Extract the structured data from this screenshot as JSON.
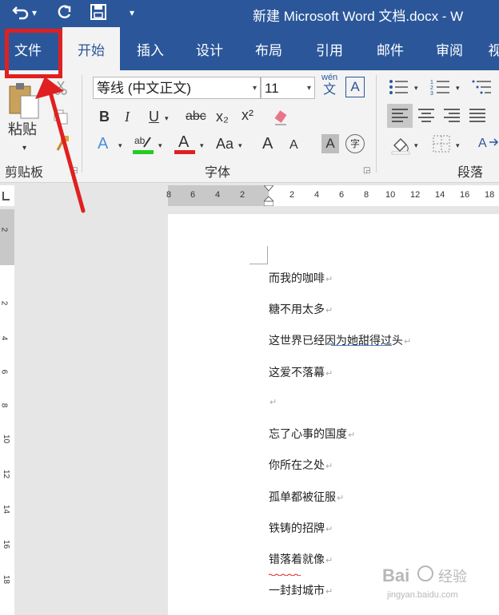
{
  "window": {
    "title": "新建 Microsoft Word 文档.docx  -  W",
    "undo_icon": "undo-icon",
    "redo_icon": "redo-icon",
    "save_icon": "save-icon",
    "qat_dropdown": "▾"
  },
  "tabs": [
    {
      "label": "文件"
    },
    {
      "label": "开始"
    },
    {
      "label": "插入"
    },
    {
      "label": "设计"
    },
    {
      "label": "布局"
    },
    {
      "label": "引用"
    },
    {
      "label": "邮件"
    },
    {
      "label": "审阅"
    },
    {
      "label": "视"
    }
  ],
  "ribbon": {
    "clipboard": {
      "paste_label": "粘贴",
      "group_label": "剪贴板"
    },
    "font": {
      "font_name": "等线 (中文正文)",
      "font_size": "11",
      "bold": "B",
      "italic": "I",
      "underline": "U",
      "strike": "abc",
      "subscript": "x₂",
      "superscript": "x²",
      "change_case": "Aa",
      "grow": "A",
      "shrink": "A",
      "char_shade": "A",
      "enclose": "字",
      "phonetic_top": "wén",
      "phonetic_bottom": "文",
      "border_char": "A",
      "group_label": "字体"
    },
    "paragraph": {
      "group_label": "段落"
    }
  },
  "ruler": {
    "top_numbers": [
      "8",
      "6",
      "4",
      "2",
      "2",
      "4",
      "6",
      "8",
      "10",
      "12",
      "14",
      "16",
      "18"
    ],
    "left_numbers": [
      "2",
      "2",
      "4",
      "6",
      "8",
      "10",
      "12",
      "14",
      "16",
      "18"
    ]
  },
  "document": {
    "lines": [
      "而我的咖啡",
      "糖不用太多",
      "这世界已经因为她甜得过头",
      "这爱不落幕",
      "",
      "忘了心事的国度",
      "你所在之处",
      "孤单都被征服",
      "铁铸的招牌",
      "错落着就像",
      "一封封城市"
    ],
    "paragraph_mark": "↵"
  },
  "colors": {
    "brand": "#2b579a",
    "highlight": "#e02020",
    "ribbon_bg": "#f3f3f3"
  },
  "watermark": {
    "text": "Bai 经验",
    "sub": "jingyan.baidu.com"
  }
}
